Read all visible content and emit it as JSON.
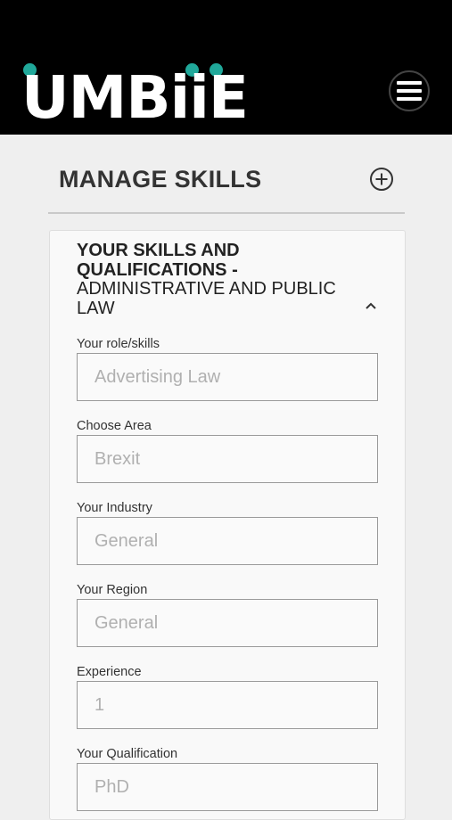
{
  "header": {
    "logo_text": "UMBiiE",
    "brand_dot_color": "#20a89a",
    "menu_icon": "hamburger-menu-icon"
  },
  "section": {
    "title": "MANAGE SKILLS",
    "add_icon": "plus-circle-icon"
  },
  "card": {
    "title_bold": "YOUR SKILLS AND QUALIFICATIONS -",
    "title_category": "ADMINISTRATIVE AND PUBLIC LAW",
    "collapse_icon": "chevron-up-icon",
    "fields": [
      {
        "label": "Your role/skills",
        "placeholder": "Advertising Law"
      },
      {
        "label": "Choose Area",
        "placeholder": "Brexit"
      },
      {
        "label": "Your Industry",
        "placeholder": "General"
      },
      {
        "label": "Your Region",
        "placeholder": "General"
      },
      {
        "label": "Experience",
        "placeholder": "1"
      },
      {
        "label": "Your Qualification",
        "placeholder": "PhD"
      }
    ]
  }
}
